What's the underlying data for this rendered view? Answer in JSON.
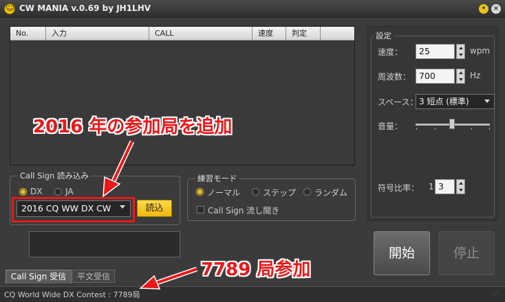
{
  "window": {
    "title": "CW MANIA v.0.69 by JH1LHV",
    "minimize_glyph": "•",
    "close_glyph": "×",
    "app_icon": "smiley-icon"
  },
  "table": {
    "columns": [
      "No.",
      "入力",
      "CALL",
      "速度",
      "判定"
    ]
  },
  "callsign_group": {
    "legend": "Call Sign 読み込み",
    "radio_dx": "DX",
    "radio_ja": "JA",
    "selected_radio": "DX",
    "select_value": "2016 CQ WW DX CW",
    "load_button": "読込"
  },
  "practice_mode": {
    "legend": "練習モード",
    "normal": "ノーマル",
    "step": "ステップ",
    "random": "ランダム",
    "selected": "ノーマル",
    "listen_checkbox": "Call Sign 流し聞き",
    "listen_checked": false
  },
  "settings": {
    "legend": "設定",
    "speed_label": "速度：",
    "speed_value": "25",
    "speed_unit": "wpm",
    "freq_label": "周波数：",
    "freq_value": "700",
    "freq_unit": "Hz",
    "space_label": "スペース：",
    "space_value": "3 短点 (標準)",
    "volume_label": "音量：",
    "volume_level": 0.5,
    "ratio_label": "符号比率：",
    "ratio_prefix": "1",
    "ratio_value": "3"
  },
  "buttons": {
    "start": "開始",
    "stop": "停止"
  },
  "tabs": {
    "callsign": "Call Sign 受信",
    "plain": "平文受信"
  },
  "status": {
    "text": "CQ World Wide DX Contest : 7789局"
  },
  "annotations": {
    "top": "2016 年の参加局を追加",
    "bottom": "7789 局参加",
    "color": "#e8191b"
  }
}
